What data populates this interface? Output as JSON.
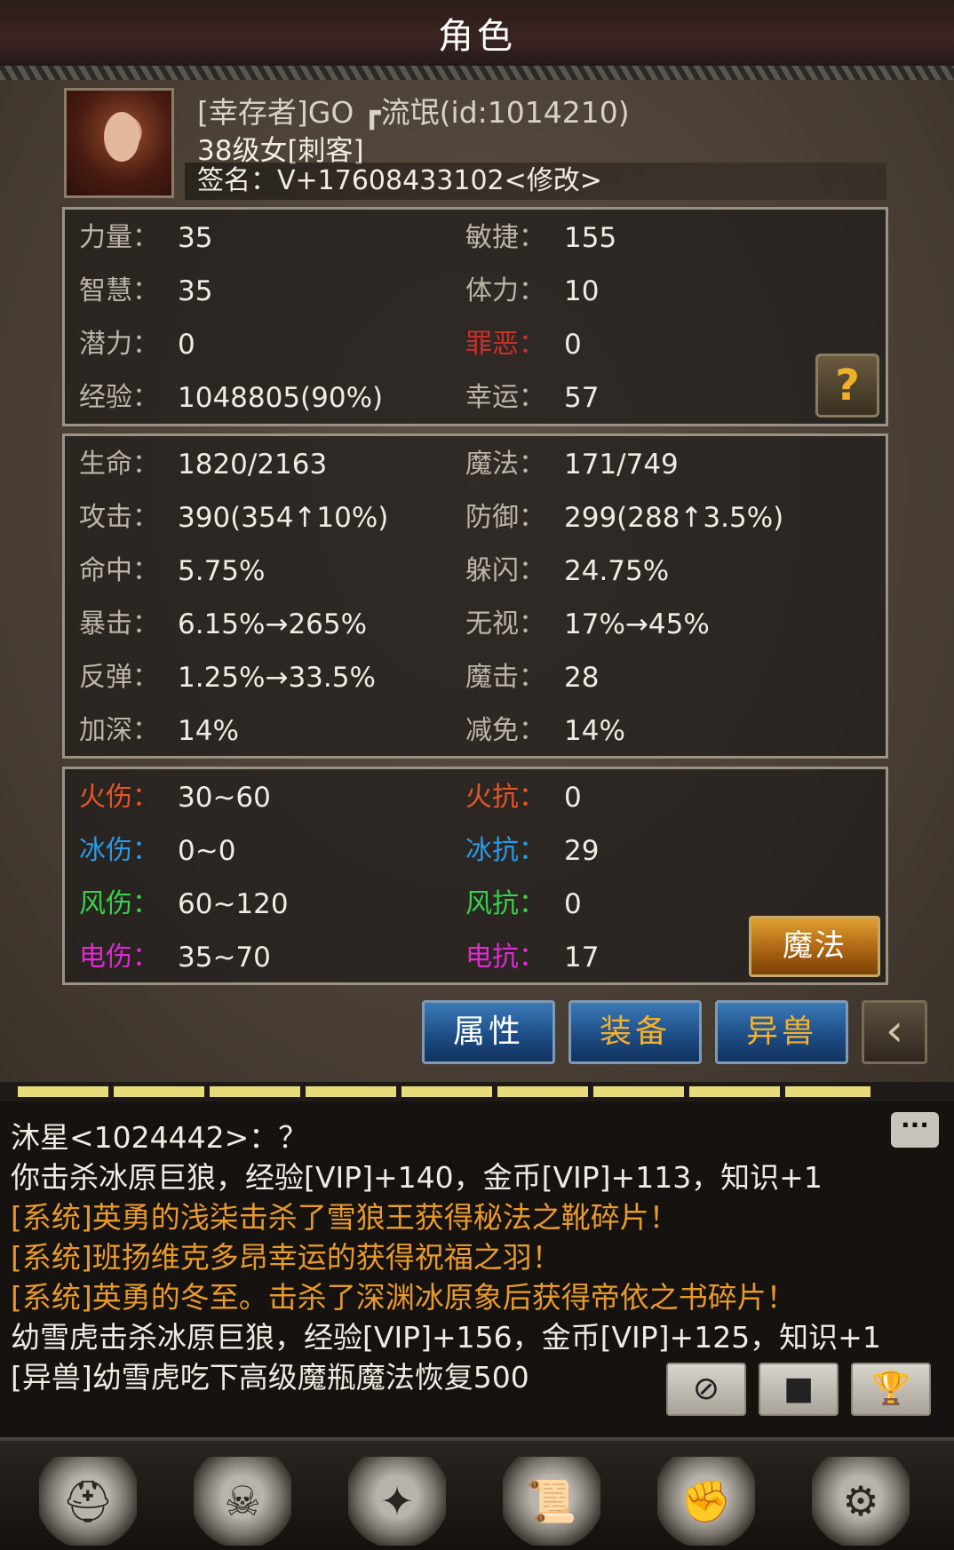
{
  "header": {
    "title": "角色"
  },
  "profile": {
    "name": "[幸存者]GO ┏流氓(id:1014210)",
    "level": "38级女[刺客]",
    "signature": "签名：V+17608433102<修改>"
  },
  "attributes": [
    {
      "label": "力量：",
      "value": "35"
    },
    {
      "label": "敏捷：",
      "value": "155"
    },
    {
      "label": "智慧：",
      "value": "35"
    },
    {
      "label": "体力：",
      "value": "10"
    },
    {
      "label": "潜力：",
      "value": "0"
    },
    {
      "label": "罪恶：",
      "value": "0"
    },
    {
      "label": "经验：",
      "value": "1048805(90%)"
    },
    {
      "label": "幸运：",
      "value": "57"
    }
  ],
  "combat": [
    {
      "label": "生命：",
      "value": "1820/2163"
    },
    {
      "label": "魔法：",
      "value": "171/749"
    },
    {
      "label": "攻击：",
      "value": "390(354↑10%)"
    },
    {
      "label": "防御：",
      "value": "299(288↑3.5%)"
    },
    {
      "label": "命中：",
      "value": "5.75%"
    },
    {
      "label": "躲闪：",
      "value": "24.75%"
    },
    {
      "label": "暴击：",
      "value": "6.15%→265%"
    },
    {
      "label": "无视：",
      "value": "17%→45%"
    },
    {
      "label": "反弹：",
      "value": "1.25%→33.5%"
    },
    {
      "label": "魔击：",
      "value": "28"
    },
    {
      "label": "加深：",
      "value": "14%"
    },
    {
      "label": "减免：",
      "value": "14%"
    }
  ],
  "elements": [
    {
      "label": "火伤：",
      "value": "30~60"
    },
    {
      "label": "火抗：",
      "value": "0"
    },
    {
      "label": "冰伤：",
      "value": "0~0"
    },
    {
      "label": "冰抗：",
      "value": "29"
    },
    {
      "label": "风伤：",
      "value": "60~120"
    },
    {
      "label": "风抗：",
      "value": "0"
    },
    {
      "label": "电伤：",
      "value": "35~70"
    },
    {
      "label": "电抗：",
      "value": "17"
    }
  ],
  "colors": {
    "sin_label": "#c8302a",
    "fire": "#e8542a",
    "ice": "#2a9ae8",
    "wind": "#36d24a",
    "electric": "#e02ad4",
    "system_msg": "#e89a2a"
  },
  "buttons": {
    "help": "?",
    "magic": "魔法",
    "attributes_tab": "属性",
    "equipment_tab": "装备",
    "pet_tab": "异兽",
    "back": "‹"
  },
  "xp_progress": 0.9,
  "chat": [
    {
      "text": "沐星<1024442>：？",
      "type": "normal"
    },
    {
      "text": "你击杀冰原巨狼，经验[VIP]+140，金币[VIP]+113，知识+1",
      "type": "normal"
    },
    {
      "text": "[系统]英勇的浅柒击杀了雪狼王获得秘法之靴碎片！",
      "type": "system"
    },
    {
      "text": "[系统]班扬维克多昂幸运的获得祝福之羽！",
      "type": "system"
    },
    {
      "text": "[系统]英勇的冬至。击杀了深渊冰原象后获得帝依之书碎片！",
      "type": "system"
    },
    {
      "text": "幼雪虎击杀冰原巨狼，经验[VIP]+156，金币[VIP]+125，知识+1",
      "type": "normal"
    },
    {
      "text": "[异兽]幼雪虎吃下高级魔瓶魔法恢复500",
      "type": "normal"
    }
  ],
  "chat_icon": "speech-bubble-icon",
  "tools": [
    {
      "icon": "compass-icon",
      "glyph": "⊘"
    },
    {
      "icon": "stop-icon",
      "glyph": "■"
    },
    {
      "icon": "trophy-icon",
      "glyph": "🏆"
    }
  ],
  "nav": [
    {
      "icon": "helmet-icon",
      "glyph": "⛑"
    },
    {
      "icon": "backpack-icon",
      "glyph": "☠"
    },
    {
      "icon": "spellbook-icon",
      "glyph": "✦"
    },
    {
      "icon": "scroll-icon",
      "glyph": "📜"
    },
    {
      "icon": "gauntlet-icon",
      "glyph": "✊"
    },
    {
      "icon": "settings-gear-icon",
      "glyph": "⚙"
    }
  ]
}
